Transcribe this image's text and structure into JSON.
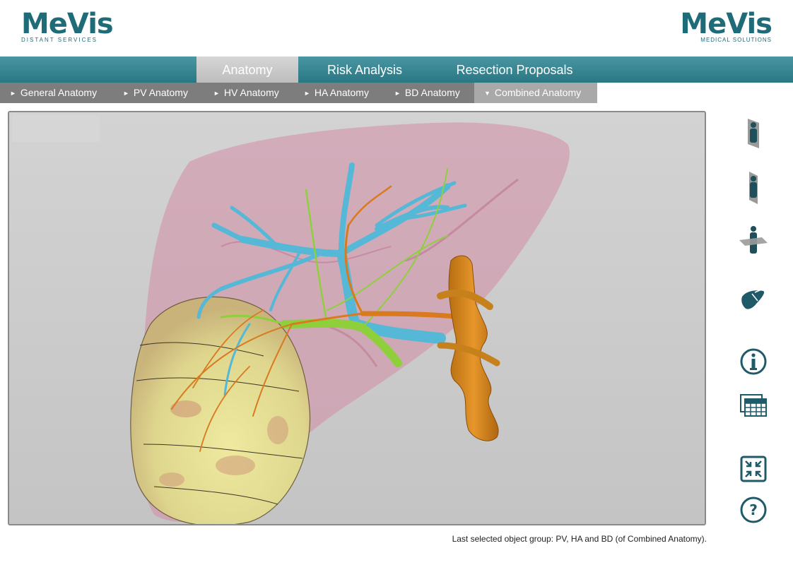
{
  "header": {
    "left_logo": {
      "name": "MeVis",
      "tagline": "DISTANT SERVICES"
    },
    "right_logo": {
      "name": "MeVis",
      "tagline": "MEDICAL SOLUTIONS"
    }
  },
  "main_tabs": [
    {
      "label": "Anatomy",
      "active": true
    },
    {
      "label": "Risk Analysis",
      "active": false
    },
    {
      "label": "Resection Proposals",
      "active": false
    }
  ],
  "sub_tabs": [
    {
      "label": "General Anatomy",
      "active": false
    },
    {
      "label": "PV Anatomy",
      "active": false
    },
    {
      "label": "HV Anatomy",
      "active": false
    },
    {
      "label": "HA Anatomy",
      "active": false
    },
    {
      "label": "BD Anatomy",
      "active": false
    },
    {
      "label": "Combined Anatomy",
      "active": true
    }
  ],
  "toolbar": [
    {
      "icon": "sagittal-view-icon"
    },
    {
      "icon": "coronal-view-icon"
    },
    {
      "icon": "axial-view-icon"
    },
    {
      "icon": "liver-3d-icon"
    },
    {
      "icon": "info-icon"
    },
    {
      "icon": "table-icon"
    },
    {
      "icon": "shrink-icon"
    },
    {
      "icon": "help-icon"
    }
  ],
  "status": {
    "text": "Last selected object group:  PV, HA and BD (of Combined Anatomy)."
  },
  "colors": {
    "brand": "#1f6b78",
    "liver": "#d48ca6",
    "portal_vein": "#55b8d6",
    "bile_duct": "#8fcf3c",
    "hepatic_artery": "#d97a1e",
    "tumor": "#e6e29a"
  }
}
